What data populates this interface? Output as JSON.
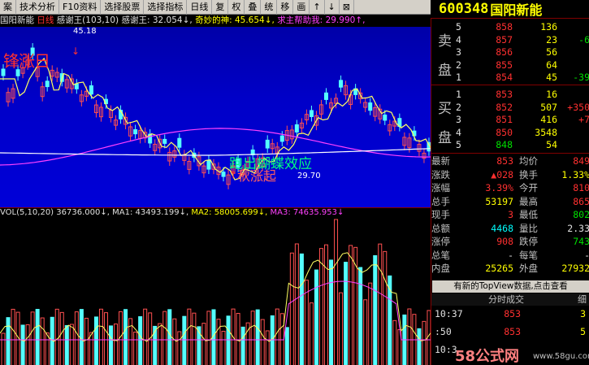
{
  "toolbar": {
    "items": [
      "案",
      "技术分析",
      "F10资料",
      "选择股票",
      "选择指标",
      "日线",
      "复",
      "权",
      "叠",
      "统",
      "移",
      "画",
      "↑",
      "↓",
      "⊠"
    ]
  },
  "stock": {
    "code": "600348",
    "name": "国阳新能"
  },
  "info": {
    "name": "国阳新能",
    "period": "日线",
    "ind": "感谢王(103,10)",
    "s1": "感谢王: 32.054↓,",
    "s2": "奇妙的神: 45.654↓,",
    "s3": "求主帮助我: 29.990↑,"
  },
  "chart_labels": {
    "high": "45.18",
    "low": "29.70",
    "overlay_main": "跑出蝴蝶效应",
    "overlay_sub": "秋涨起",
    "overlay_topleft": "锋涨日"
  },
  "vol": {
    "label": "VOL(5,10,20)",
    "v": "36736.000↓,",
    "ma1": "MA1: 43493.199↓,",
    "ma2": "MA2: 58005.699↓,",
    "ma3": "MA3: 74635.953↓"
  },
  "orderbook": {
    "sell_label": [
      "卖",
      "盘"
    ],
    "buy_label": [
      "买",
      "盘"
    ],
    "sells": [
      {
        "lvl": "5",
        "price": "858",
        "vol": "136",
        "chg": ""
      },
      {
        "lvl": "4",
        "price": "857",
        "vol": "23",
        "chg": "-6"
      },
      {
        "lvl": "3",
        "price": "856",
        "vol": "56",
        "chg": ""
      },
      {
        "lvl": "2",
        "price": "855",
        "vol": "64",
        "chg": ""
      },
      {
        "lvl": "1",
        "price": "854",
        "vol": "45",
        "chg": "-39"
      }
    ],
    "buys": [
      {
        "lvl": "1",
        "price": "853",
        "vol": "16",
        "chg": ""
      },
      {
        "lvl": "2",
        "price": "852",
        "vol": "507",
        "chg": "+350"
      },
      {
        "lvl": "3",
        "price": "851",
        "vol": "416",
        "chg": "+7"
      },
      {
        "lvl": "4",
        "price": "850",
        "vol": "3548",
        "chg": ""
      },
      {
        "lvl": "5",
        "price": "848",
        "vol": "54",
        "chg": ""
      }
    ]
  },
  "stats": [
    {
      "k1": "最新",
      "v1": "853",
      "k2": "均价",
      "v2": "849"
    },
    {
      "k1": "涨跌",
      "v1": "▲028",
      "k2": "换手",
      "v2": "1.33%"
    },
    {
      "k1": "涨幅",
      "v1": "3.39%",
      "k2": "今开",
      "v2": "810"
    },
    {
      "k1": "总手",
      "v1": "53197",
      "k2": "最高",
      "v2": "865"
    },
    {
      "k1": "现手",
      "v1": "3",
      "k2": "最低",
      "v2": "802"
    },
    {
      "k1": "总额",
      "v1": "4468",
      "k2": "量比",
      "v2": "2.33"
    },
    {
      "k1": "涨停",
      "v1": "908",
      "k2": "跌停",
      "v2": "743"
    },
    {
      "k1": "总笔",
      "v1": "-",
      "k2": "每笔",
      "v2": "-"
    },
    {
      "k1": "内盘",
      "v1": "25265",
      "k2": "外盘",
      "v2": "27932"
    }
  ],
  "topview": "有新的TopView数据,点击查看",
  "fenshi": {
    "title": "分时成交",
    "tab2": "细"
  },
  "trades": [
    {
      "time": "10:37",
      "price": "853",
      "vol": "3"
    },
    {
      "time": ":50",
      "price": "853",
      "vol": "5"
    },
    {
      "time": "10:3",
      "price": "",
      "vol": ""
    }
  ],
  "watermark": {
    "brand": "58公式网",
    "url": "www.58gu.com"
  }
}
